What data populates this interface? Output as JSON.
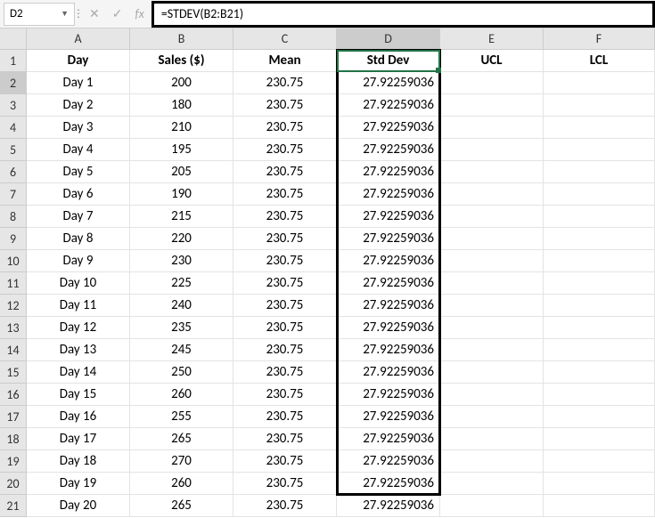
{
  "nameBox": "D2",
  "formula": "=STDEV(B2:B21)",
  "columns": [
    "A",
    "B",
    "C",
    "D",
    "E",
    "F"
  ],
  "headers": {
    "A": "Day",
    "B": "Sales ($)",
    "C": "Mean",
    "D": "Std Dev",
    "E": "UCL",
    "F": "LCL"
  },
  "rows": [
    {
      "n": 1
    },
    {
      "n": 2,
      "day": "Day 1",
      "sales": "200",
      "mean": "230.75",
      "std": "27.92259036"
    },
    {
      "n": 3,
      "day": "Day 2",
      "sales": "180",
      "mean": "230.75",
      "std": "27.92259036"
    },
    {
      "n": 4,
      "day": "Day 3",
      "sales": "210",
      "mean": "230.75",
      "std": "27.92259036"
    },
    {
      "n": 5,
      "day": "Day 4",
      "sales": "195",
      "mean": "230.75",
      "std": "27.92259036"
    },
    {
      "n": 6,
      "day": "Day 5",
      "sales": "205",
      "mean": "230.75",
      "std": "27.92259036"
    },
    {
      "n": 7,
      "day": "Day 6",
      "sales": "190",
      "mean": "230.75",
      "std": "27.92259036"
    },
    {
      "n": 8,
      "day": "Day 7",
      "sales": "215",
      "mean": "230.75",
      "std": "27.92259036"
    },
    {
      "n": 9,
      "day": "Day 8",
      "sales": "220",
      "mean": "230.75",
      "std": "27.92259036"
    },
    {
      "n": 10,
      "day": "Day 9",
      "sales": "230",
      "mean": "230.75",
      "std": "27.92259036"
    },
    {
      "n": 11,
      "day": "Day 10",
      "sales": "225",
      "mean": "230.75",
      "std": "27.92259036"
    },
    {
      "n": 12,
      "day": "Day 11",
      "sales": "240",
      "mean": "230.75",
      "std": "27.92259036"
    },
    {
      "n": 13,
      "day": "Day 12",
      "sales": "235",
      "mean": "230.75",
      "std": "27.92259036"
    },
    {
      "n": 14,
      "day": "Day 13",
      "sales": "245",
      "mean": "230.75",
      "std": "27.92259036"
    },
    {
      "n": 15,
      "day": "Day 14",
      "sales": "250",
      "mean": "230.75",
      "std": "27.92259036"
    },
    {
      "n": 16,
      "day": "Day 15",
      "sales": "260",
      "mean": "230.75",
      "std": "27.92259036"
    },
    {
      "n": 17,
      "day": "Day 16",
      "sales": "255",
      "mean": "230.75",
      "std": "27.92259036"
    },
    {
      "n": 18,
      "day": "Day 17",
      "sales": "265",
      "mean": "230.75",
      "std": "27.92259036"
    },
    {
      "n": 19,
      "day": "Day 18",
      "sales": "270",
      "mean": "230.75",
      "std": "27.92259036"
    },
    {
      "n": 20,
      "day": "Day 19",
      "sales": "260",
      "mean": "230.75",
      "std": "27.92259036"
    },
    {
      "n": 21,
      "day": "Day 20",
      "sales": "265",
      "mean": "230.75",
      "std": "27.92259036"
    }
  ],
  "activeColumn": "D",
  "activeRow": 2
}
